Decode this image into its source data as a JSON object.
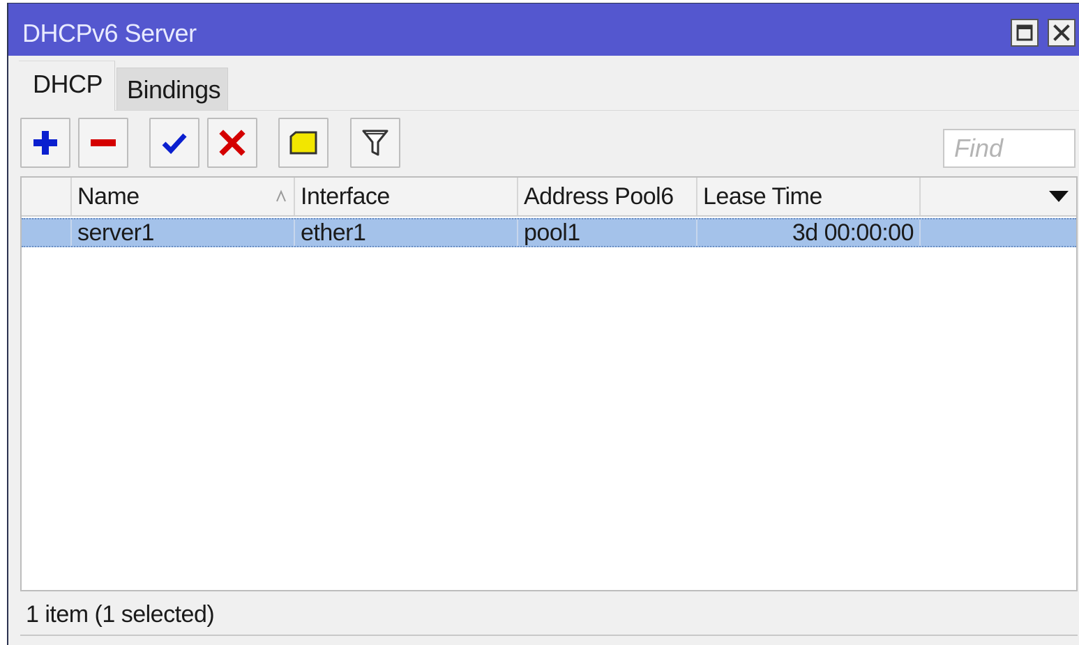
{
  "window": {
    "title": "DHCPv6 Server"
  },
  "tabs": [
    {
      "label": "DHCP",
      "active": true
    },
    {
      "label": "Bindings",
      "active": false
    }
  ],
  "toolbar": {
    "buttons": [
      {
        "name": "add",
        "icon": "plus-icon",
        "color": "#0a1fcf"
      },
      {
        "name": "remove",
        "icon": "minus-icon",
        "color": "#d40000"
      },
      {
        "name": "enable",
        "icon": "check-icon",
        "color": "#0a1fcf"
      },
      {
        "name": "disable",
        "icon": "x-icon",
        "color": "#d40000"
      },
      {
        "name": "comment",
        "icon": "note-icon",
        "color": "#f2e600"
      },
      {
        "name": "filter",
        "icon": "funnel-icon",
        "color": "#333333"
      }
    ],
    "find_placeholder": "Find"
  },
  "table": {
    "columns": [
      "",
      "Name",
      "Interface",
      "Address Pool6",
      "Lease Time",
      ""
    ],
    "sorted_column": "Name",
    "rows": [
      {
        "flag": "",
        "name": "server1",
        "interface": "ether1",
        "address_pool6": "pool1",
        "lease_time": "3d 00:00:00",
        "extra": "",
        "selected": true
      }
    ]
  },
  "status": {
    "text": "1 item (1 selected)"
  },
  "colors": {
    "titlebar": "#5457cf",
    "selection": "#a4c2ea",
    "window_bg": "#f0f0f0"
  }
}
